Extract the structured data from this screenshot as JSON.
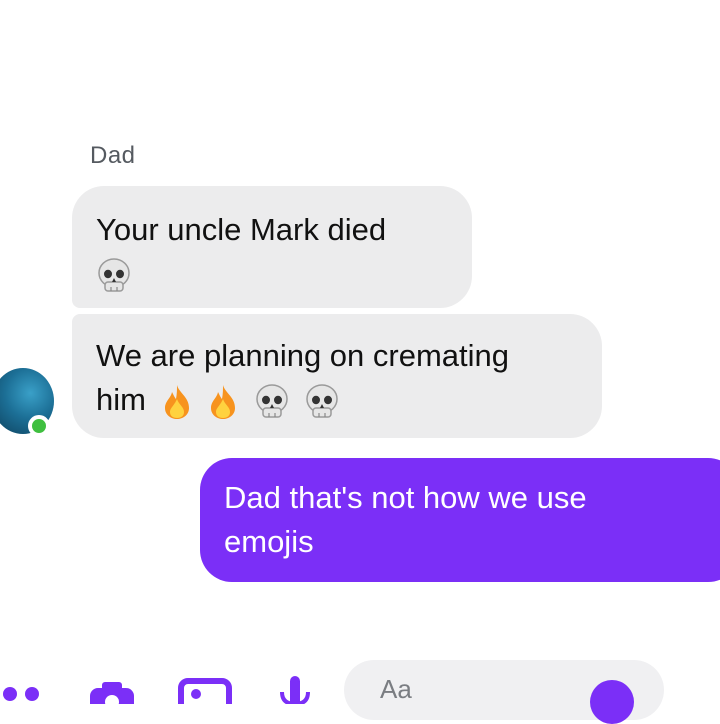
{
  "conversation": {
    "sender_name": "Dad",
    "messages": [
      {
        "direction": "incoming",
        "lines": [
          "Your uncle Mark died"
        ],
        "emojis": [
          "skull"
        ]
      },
      {
        "direction": "incoming",
        "lines": [
          "We are planning on cremating",
          "him"
        ],
        "emojis": [
          "fire",
          "fire",
          "skull",
          "skull"
        ]
      },
      {
        "direction": "outgoing",
        "lines": [
          "Dad that's not how we use",
          "emojis"
        ]
      }
    ]
  },
  "composer": {
    "placeholder": "Aa",
    "icons": [
      "more-icon",
      "camera-icon",
      "image-icon",
      "mic-icon",
      "emoji-icon"
    ]
  },
  "colors": {
    "incoming_bubble": "#ececed",
    "outgoing_bubble": "#7b2ff7",
    "online_status": "#3fbf3f"
  }
}
